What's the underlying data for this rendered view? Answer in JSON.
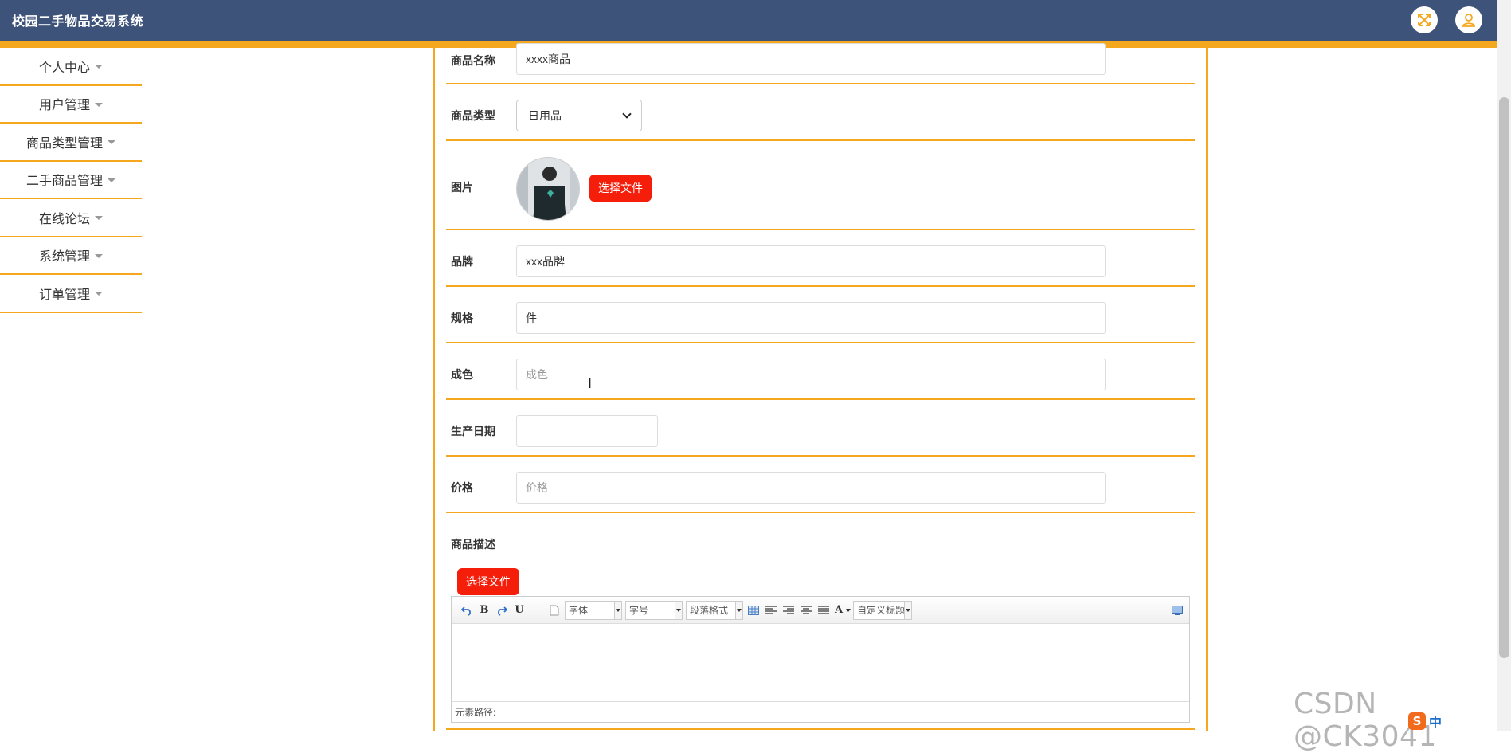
{
  "app": {
    "title": "校园二手物品交易系统"
  },
  "header": {
    "fullscreen_icon": "fullscreen-icon",
    "user_icon": "user-icon",
    "accent_color": "#f5a81e",
    "bar_color": "#3d5379"
  },
  "sidebar": {
    "items": [
      {
        "label": "个人中心"
      },
      {
        "label": "用户管理"
      },
      {
        "label": "商品类型管理"
      },
      {
        "label": "二手商品管理"
      },
      {
        "label": "在线论坛"
      },
      {
        "label": "系统管理"
      },
      {
        "label": "订单管理"
      }
    ]
  },
  "form": {
    "name": {
      "label": "商品名称",
      "value": "xxxx商品"
    },
    "type": {
      "label": "商品类型",
      "value": "日用品"
    },
    "image": {
      "label": "图片",
      "button": "选择文件"
    },
    "brand": {
      "label": "品牌",
      "value": "xxx品牌"
    },
    "spec": {
      "label": "规格",
      "value": "件"
    },
    "condition": {
      "label": "成色",
      "placeholder": "成色"
    },
    "date": {
      "label": "生产日期",
      "value": ""
    },
    "price": {
      "label": "价格",
      "placeholder": "价格"
    },
    "description": {
      "label": "商品描述",
      "button": "选择文件"
    }
  },
  "editor": {
    "font_family": "字体",
    "font_size": "字号",
    "paragraph": "段落格式",
    "custom_title": "自定义标题",
    "bold": "B",
    "underline": "U",
    "hr": "—",
    "font_color": "A",
    "status_path": "元素路径:"
  },
  "watermark": {
    "text": "CSDN @CK3041"
  },
  "ime": {
    "lang": "中"
  }
}
